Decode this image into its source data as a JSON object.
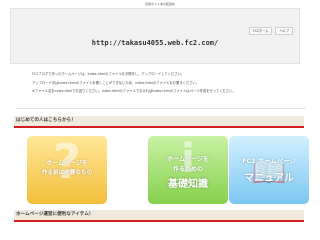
{
  "topline": "忍者ホスト本の転送先",
  "header": {
    "url": "http://takasu4055.web.fc2.com/",
    "links": [
      "FC2ホーム",
      "ヘルプ"
    ]
  },
  "notes": [
    "FC2ブログで作ったホームページは、index.htmlのファイルをお開きし、アップロードしてください。",
    "アップロード中はindex.htmlのファイルを開くことができないため、index.htmlのファイルをお開きください。",
    "※ファイル名をindex.htmlでお送りください。index.htmlのファイルでなければindex.htmlのファイルはページ作成を行ってください。"
  ],
  "sections": {
    "beginners": "はじめての人はこちらから！",
    "items": "ホームページ運営に便利なアイテム！"
  },
  "cards": [
    {
      "line1": "ホームページを",
      "line2": "作る前に必要なもの",
      "glyph": "?"
    },
    {
      "line1": "ホームページを",
      "line2": "作るための",
      "line3": "基礎知識",
      "glyph": "i"
    },
    {
      "line1": "FC2 ホームページ",
      "line2": "マニュアル",
      "glyph": "📖"
    }
  ],
  "colors": {
    "accent_red": "#d21f1f",
    "section_bg": "#efeadd",
    "card_yellow": "#f2bf3a",
    "card_green": "#86d04b",
    "card_blue": "#7cc6f0"
  }
}
